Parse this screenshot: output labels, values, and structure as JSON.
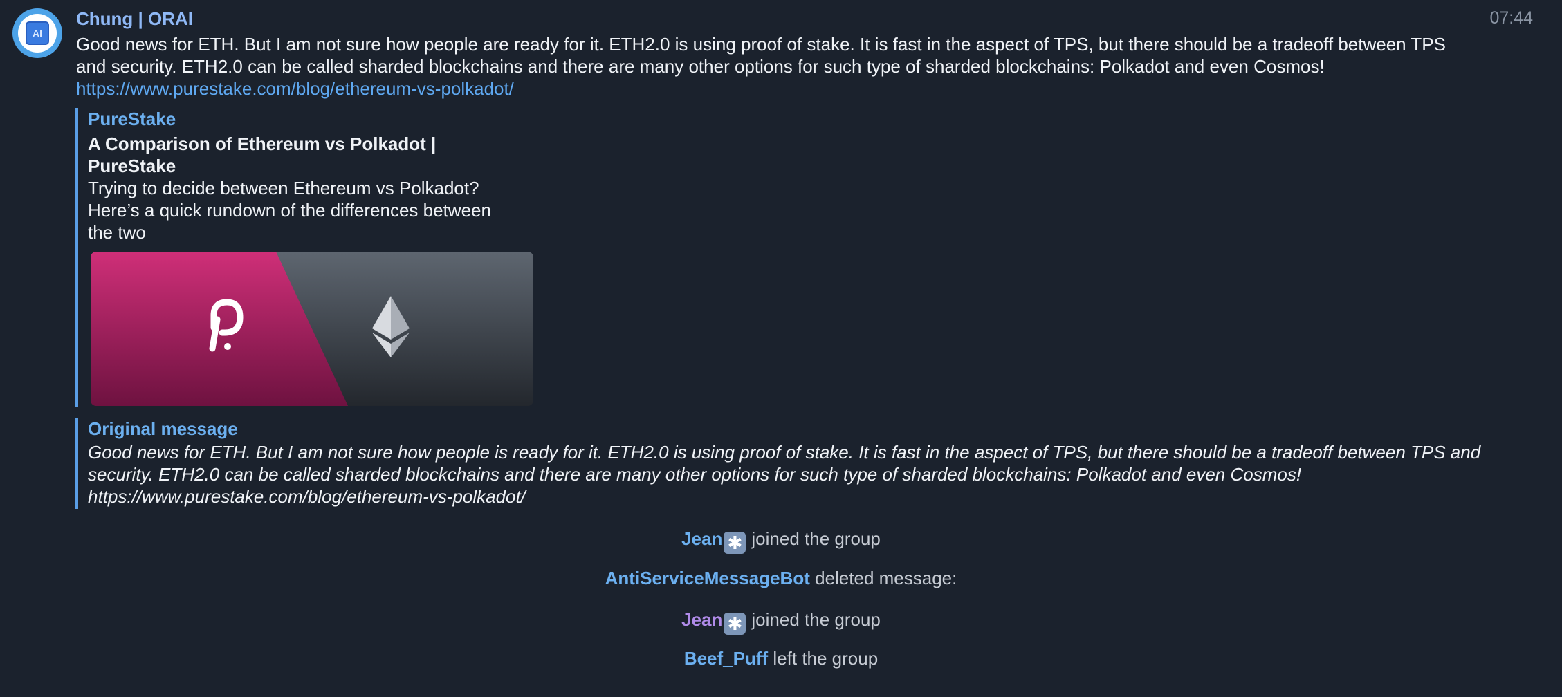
{
  "message": {
    "sender": "Chung | ORAI",
    "time": "07:44",
    "avatar_icon": "ai-chip-icon",
    "text": "Good news for ETH. But I am not sure how people are ready for it. ETH2.0 is using proof of stake. It is fast in the aspect of TPS, but there should be a tradeoff between TPS and security. ETH2.0 can be called sharded blockchains and there are many other options for such type of sharded blockchains: Polkadot and even Cosmos!",
    "link": "https://www.purestake.com/blog/ethereum-vs-polkadot/"
  },
  "preview": {
    "site": "PureStake",
    "title": "A Comparison of Ethereum vs Polkadot | PureStake",
    "description": "Trying to decide between Ethereum vs Polkadot? Here’s a quick rundown of the differences between the two",
    "image_icons": [
      "polkadot-logo-icon",
      "ethereum-logo-icon"
    ],
    "colors": {
      "left": "#c42f72",
      "right": "#4b525a"
    }
  },
  "original": {
    "title": "Original message",
    "text": "Good news for ETH. But I am not sure how people is ready for it. ETH2.0 is using proof of stake. It is fast in the aspect of TPS, but there should be a tradeoff between TPS and security. ETH2.0 can be called sharded blockchains and there are many other options for such type of sharded blockchains: Polkadot and even Cosmos! https://www.purestake.com/blog/ethereum-vs-polkadot/"
  },
  "service": [
    {
      "name": "Jean",
      "badge": "✱",
      "action": "joined the group"
    },
    {
      "name": "AntiServiceMessageBot",
      "action": "deleted message:"
    },
    {
      "name": "Jean",
      "badge": "✱",
      "action": "joined the group"
    },
    {
      "name": "Beef_Puff",
      "action": "left the group"
    }
  ]
}
